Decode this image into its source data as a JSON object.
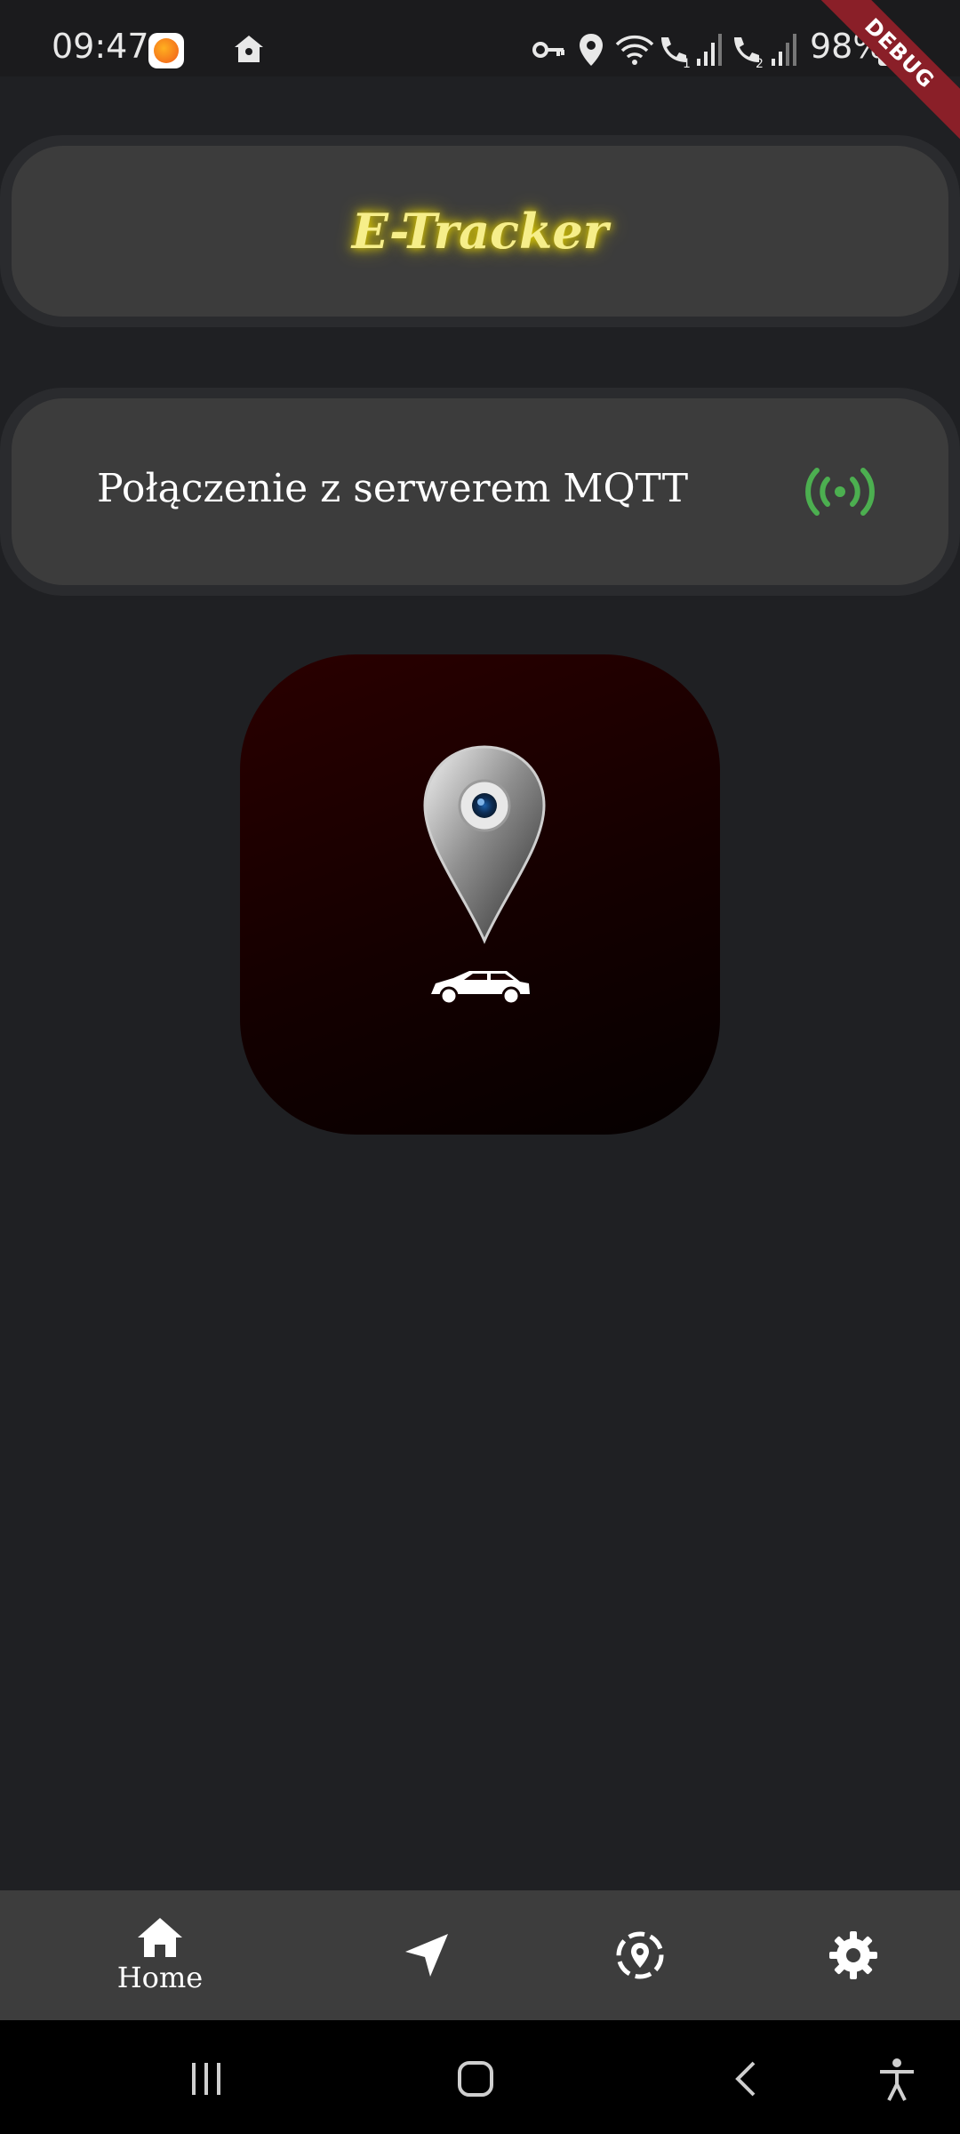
{
  "status_bar": {
    "time": "09:47",
    "battery": "98%",
    "icons": [
      "app-notification-icon",
      "home-icon",
      "vpn-key-icon",
      "location-icon",
      "wifi-icon",
      "wifi-call-1-icon",
      "signal-1-icon",
      "wifi-call-2-icon",
      "signal-2-icon",
      "battery-icon"
    ]
  },
  "debug_banner": "DEBUG",
  "header": {
    "title": "E-Tracker"
  },
  "mqtt_card": {
    "label": "Połączenie z serwerem MQTT",
    "status_icon": "broadcast-icon",
    "status_color": "#4caf50"
  },
  "logo": {
    "icons": [
      "map-pin-icon",
      "car-icon"
    ],
    "bg_color": "#2a0000"
  },
  "bottom_nav": {
    "items": [
      {
        "icon": "home-icon",
        "label": "Home"
      },
      {
        "icon": "navigation-arrow-icon",
        "label": ""
      },
      {
        "icon": "location-target-icon",
        "label": ""
      },
      {
        "icon": "gear-icon",
        "label": ""
      }
    ]
  },
  "system_nav": {
    "icons": [
      "recent-apps-icon",
      "home-circle-icon",
      "back-icon",
      "accessibility-icon"
    ]
  }
}
